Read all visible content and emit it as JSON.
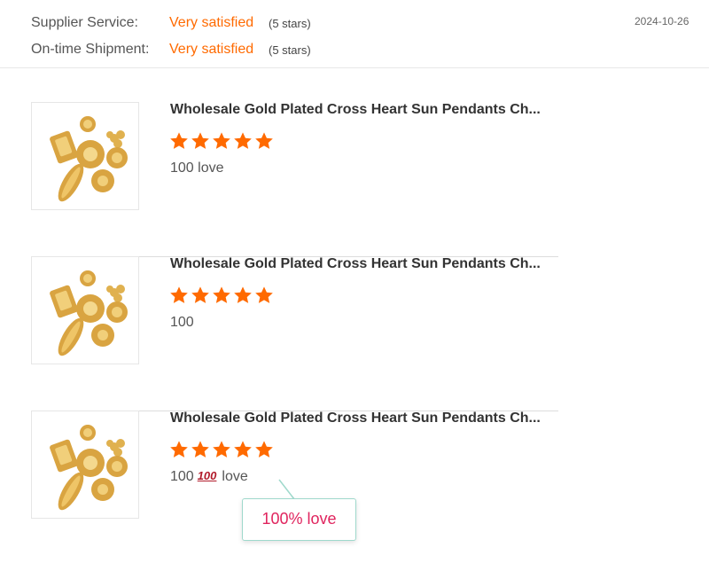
{
  "ratings": {
    "supplier_service": {
      "label": "Supplier Service:",
      "value": "Very satisfied",
      "note": "(5 stars)"
    },
    "on_time_shipment": {
      "label": "On-time Shipment:",
      "value": "Very satisfied",
      "note": "(5 stars)"
    },
    "date": "2024-10-26"
  },
  "reviews": [
    {
      "title": "Wholesale Gold Plated Cross Heart Sun Pendants Ch...",
      "rating": 5,
      "comment": "100 love"
    },
    {
      "title": "Wholesale Gold Plated Cross Heart Sun Pendants Ch...",
      "rating": 5,
      "comment": "100"
    },
    {
      "title": "Wholesale Gold Plated Cross Heart Sun Pendants Ch...",
      "rating": 5,
      "comment_prefix": "100",
      "comment_emoji": "100",
      "comment_suffix": "love"
    }
  ],
  "tooltip": {
    "text": "100% love"
  },
  "colors": {
    "accent": "#ff6a00",
    "tooltip_text": "#e0245e",
    "tooltip_border": "#9fd9cc"
  },
  "icons": {
    "star": "star-icon",
    "hundred": "hundred-points-emoji"
  }
}
